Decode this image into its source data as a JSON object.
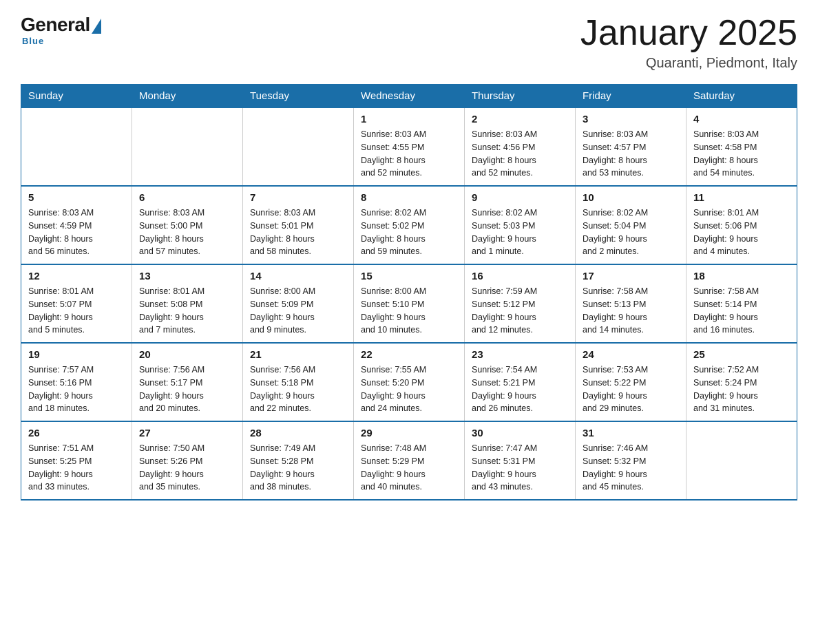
{
  "logo": {
    "general": "General",
    "blue": "Blue",
    "subtitle": "Blue"
  },
  "header": {
    "title": "January 2025",
    "subtitle": "Quaranti, Piedmont, Italy"
  },
  "days_of_week": [
    "Sunday",
    "Monday",
    "Tuesday",
    "Wednesday",
    "Thursday",
    "Friday",
    "Saturday"
  ],
  "weeks": [
    {
      "days": [
        {
          "num": "",
          "info": ""
        },
        {
          "num": "",
          "info": ""
        },
        {
          "num": "",
          "info": ""
        },
        {
          "num": "1",
          "info": "Sunrise: 8:03 AM\nSunset: 4:55 PM\nDaylight: 8 hours\nand 52 minutes."
        },
        {
          "num": "2",
          "info": "Sunrise: 8:03 AM\nSunset: 4:56 PM\nDaylight: 8 hours\nand 52 minutes."
        },
        {
          "num": "3",
          "info": "Sunrise: 8:03 AM\nSunset: 4:57 PM\nDaylight: 8 hours\nand 53 minutes."
        },
        {
          "num": "4",
          "info": "Sunrise: 8:03 AM\nSunset: 4:58 PM\nDaylight: 8 hours\nand 54 minutes."
        }
      ]
    },
    {
      "days": [
        {
          "num": "5",
          "info": "Sunrise: 8:03 AM\nSunset: 4:59 PM\nDaylight: 8 hours\nand 56 minutes."
        },
        {
          "num": "6",
          "info": "Sunrise: 8:03 AM\nSunset: 5:00 PM\nDaylight: 8 hours\nand 57 minutes."
        },
        {
          "num": "7",
          "info": "Sunrise: 8:03 AM\nSunset: 5:01 PM\nDaylight: 8 hours\nand 58 minutes."
        },
        {
          "num": "8",
          "info": "Sunrise: 8:02 AM\nSunset: 5:02 PM\nDaylight: 8 hours\nand 59 minutes."
        },
        {
          "num": "9",
          "info": "Sunrise: 8:02 AM\nSunset: 5:03 PM\nDaylight: 9 hours\nand 1 minute."
        },
        {
          "num": "10",
          "info": "Sunrise: 8:02 AM\nSunset: 5:04 PM\nDaylight: 9 hours\nand 2 minutes."
        },
        {
          "num": "11",
          "info": "Sunrise: 8:01 AM\nSunset: 5:06 PM\nDaylight: 9 hours\nand 4 minutes."
        }
      ]
    },
    {
      "days": [
        {
          "num": "12",
          "info": "Sunrise: 8:01 AM\nSunset: 5:07 PM\nDaylight: 9 hours\nand 5 minutes."
        },
        {
          "num": "13",
          "info": "Sunrise: 8:01 AM\nSunset: 5:08 PM\nDaylight: 9 hours\nand 7 minutes."
        },
        {
          "num": "14",
          "info": "Sunrise: 8:00 AM\nSunset: 5:09 PM\nDaylight: 9 hours\nand 9 minutes."
        },
        {
          "num": "15",
          "info": "Sunrise: 8:00 AM\nSunset: 5:10 PM\nDaylight: 9 hours\nand 10 minutes."
        },
        {
          "num": "16",
          "info": "Sunrise: 7:59 AM\nSunset: 5:12 PM\nDaylight: 9 hours\nand 12 minutes."
        },
        {
          "num": "17",
          "info": "Sunrise: 7:58 AM\nSunset: 5:13 PM\nDaylight: 9 hours\nand 14 minutes."
        },
        {
          "num": "18",
          "info": "Sunrise: 7:58 AM\nSunset: 5:14 PM\nDaylight: 9 hours\nand 16 minutes."
        }
      ]
    },
    {
      "days": [
        {
          "num": "19",
          "info": "Sunrise: 7:57 AM\nSunset: 5:16 PM\nDaylight: 9 hours\nand 18 minutes."
        },
        {
          "num": "20",
          "info": "Sunrise: 7:56 AM\nSunset: 5:17 PM\nDaylight: 9 hours\nand 20 minutes."
        },
        {
          "num": "21",
          "info": "Sunrise: 7:56 AM\nSunset: 5:18 PM\nDaylight: 9 hours\nand 22 minutes."
        },
        {
          "num": "22",
          "info": "Sunrise: 7:55 AM\nSunset: 5:20 PM\nDaylight: 9 hours\nand 24 minutes."
        },
        {
          "num": "23",
          "info": "Sunrise: 7:54 AM\nSunset: 5:21 PM\nDaylight: 9 hours\nand 26 minutes."
        },
        {
          "num": "24",
          "info": "Sunrise: 7:53 AM\nSunset: 5:22 PM\nDaylight: 9 hours\nand 29 minutes."
        },
        {
          "num": "25",
          "info": "Sunrise: 7:52 AM\nSunset: 5:24 PM\nDaylight: 9 hours\nand 31 minutes."
        }
      ]
    },
    {
      "days": [
        {
          "num": "26",
          "info": "Sunrise: 7:51 AM\nSunset: 5:25 PM\nDaylight: 9 hours\nand 33 minutes."
        },
        {
          "num": "27",
          "info": "Sunrise: 7:50 AM\nSunset: 5:26 PM\nDaylight: 9 hours\nand 35 minutes."
        },
        {
          "num": "28",
          "info": "Sunrise: 7:49 AM\nSunset: 5:28 PM\nDaylight: 9 hours\nand 38 minutes."
        },
        {
          "num": "29",
          "info": "Sunrise: 7:48 AM\nSunset: 5:29 PM\nDaylight: 9 hours\nand 40 minutes."
        },
        {
          "num": "30",
          "info": "Sunrise: 7:47 AM\nSunset: 5:31 PM\nDaylight: 9 hours\nand 43 minutes."
        },
        {
          "num": "31",
          "info": "Sunrise: 7:46 AM\nSunset: 5:32 PM\nDaylight: 9 hours\nand 45 minutes."
        },
        {
          "num": "",
          "info": ""
        }
      ]
    }
  ]
}
